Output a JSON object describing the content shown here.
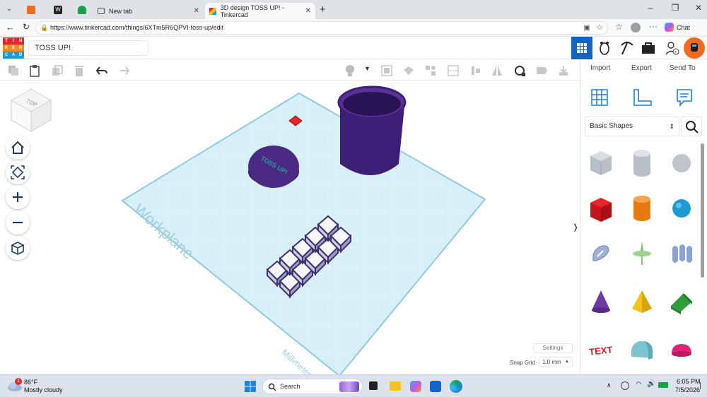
{
  "browser": {
    "tabs": [
      {
        "label": "New tab"
      },
      {
        "label": "3D design TOSS UP! - Tinkercad"
      }
    ],
    "url": "https://www.tinkercad.com/things/6XTm5R6QPVI-toss-up/edit",
    "chat_label": "Chat"
  },
  "app": {
    "logo_letters": [
      "T",
      "I",
      "N",
      "K",
      "E",
      "R",
      "C",
      "A",
      "D"
    ],
    "design_title": "TOSS UP!"
  },
  "right_panel": {
    "tabs": [
      "Import",
      "Export",
      "Send To"
    ],
    "shape_category": "Basic Shapes",
    "collapse_glyph": "❭"
  },
  "canvas": {
    "workplane_label": "Workplane",
    "units_label": "Millimeters",
    "view_cube_label": "TOP",
    "coin_text": "TOSS UP!",
    "settings_label": "Settings",
    "snap_grid_label": "Snap Grid",
    "snap_grid_value": "1.0 mm"
  },
  "taskbar": {
    "weather_temp": "86°F",
    "weather_desc": "Mostly cloudy",
    "weather_badge": "1",
    "search_placeholder": "Search",
    "time": "6:05 PM",
    "date": "7/5/2026"
  },
  "colors": {
    "accent": "#1565c0",
    "workplane": "#d6eef7",
    "workplane_edge": "#8dc9e0",
    "cup_purple": "#3e1f78",
    "shape_red": "#e5262b",
    "shape_orange": "#f08a1c",
    "shape_blue": "#1b9bd1",
    "shape_purple": "#6b3aa3",
    "shape_yellow": "#f4c41a",
    "shape_green": "#2d9e3a",
    "shape_pink": "#e0247a"
  }
}
